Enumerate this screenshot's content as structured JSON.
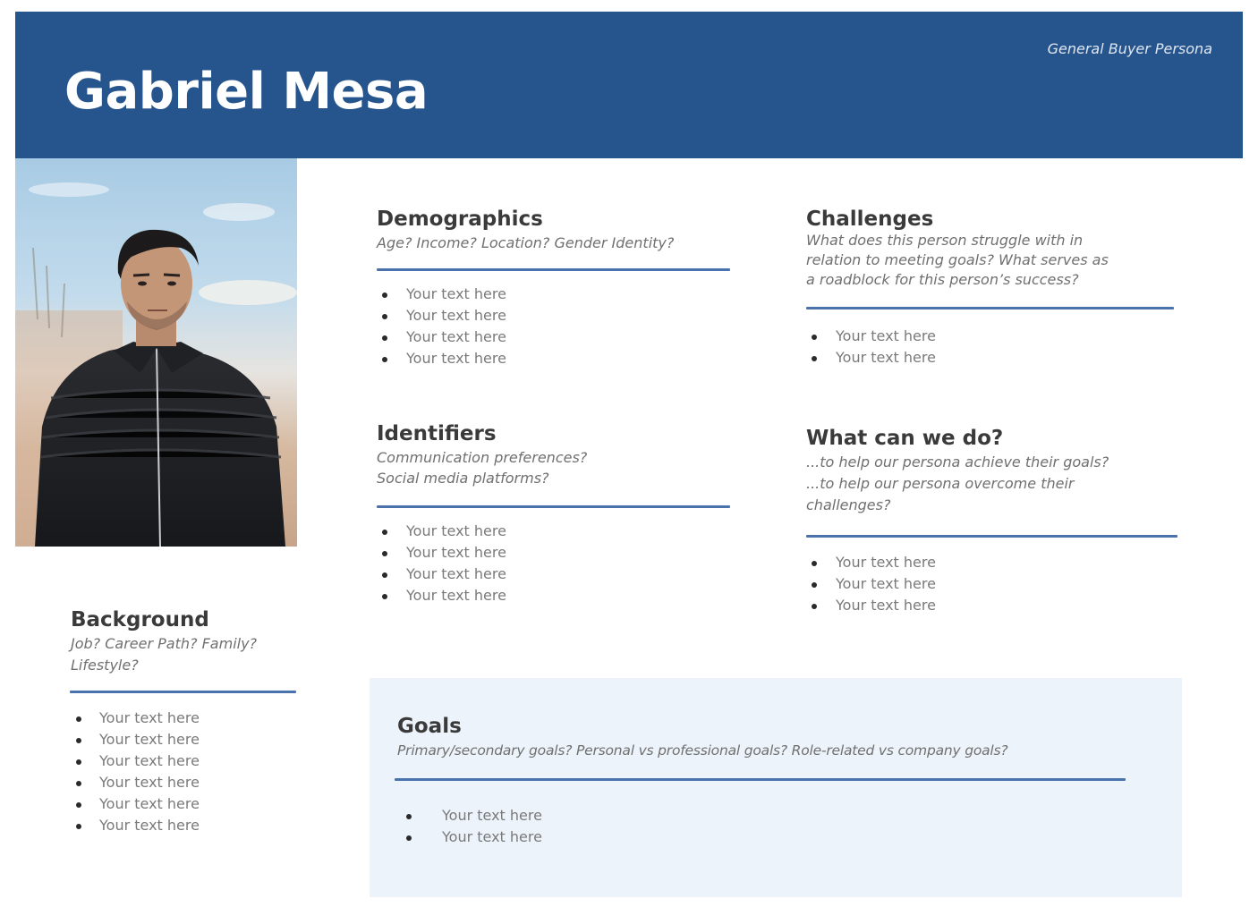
{
  "header": {
    "name": "Gabriel Mesa",
    "subtitle": "General Buyer Persona",
    "background_color": "#26548c"
  },
  "photo": {
    "alt": "Portrait photo of young man in black zip-up jacket outdoors"
  },
  "accent_color": "#4a72ad",
  "sections": {
    "demographics": {
      "title": "Demographics",
      "prompt_lines": [
        "Age? Income? Location? Gender Identity?"
      ],
      "items": [
        "Your text here",
        "Your text here",
        "Your text here",
        "Your text here"
      ]
    },
    "identifiers": {
      "title": "Identifiers",
      "prompt_lines": [
        "Communication preferences?",
        "Social media platforms?"
      ],
      "items": [
        "Your text here",
        "Your text here",
        "Your text here",
        "Your text here"
      ]
    },
    "challenges": {
      "title": "Challenges",
      "prompt_lines": [
        "What does this person struggle with in",
        "relation to meeting goals? What serves as",
        "a roadblock for this person’s success?"
      ],
      "items": [
        "Your text here",
        "Your text here"
      ]
    },
    "what_can_we_do": {
      "title": "What can we do?",
      "prompt_lines": [
        "...to help our persona achieve their goals?",
        "...to help our persona overcome their",
        "challenges?"
      ],
      "items": [
        "Your text here",
        "Your text here",
        "Your text here"
      ]
    },
    "background": {
      "title": "Background",
      "prompt_lines": [
        "Job? Career Path? Family?",
        "Lifestyle?"
      ],
      "items": [
        "Your text here",
        "Your text here",
        "Your text here",
        "Your text here",
        "Your text here",
        "Your text here"
      ]
    },
    "goals": {
      "title": "Goals",
      "prompt_lines": [
        "Primary/secondary goals?  Personal vs professional goals? Role-related vs company goals?"
      ],
      "items": [
        "Your text here",
        "Your text here"
      ],
      "panel_color": "#edf3fa"
    }
  }
}
